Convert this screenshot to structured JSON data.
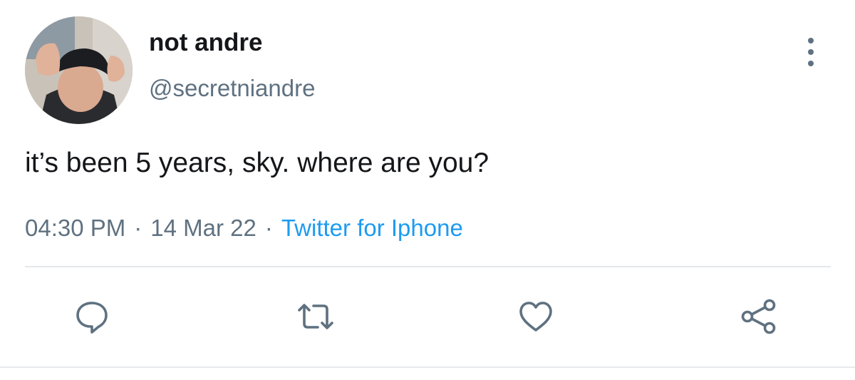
{
  "author": {
    "display_name": "not andre",
    "handle": "@secretniandre"
  },
  "tweet": {
    "text": "it’s been 5 years, sky. where are you?"
  },
  "meta": {
    "time": "04:30 PM",
    "separator": "·",
    "date": "14 Mar 22",
    "source": "Twitter for Iphone"
  },
  "icons": {
    "more": "more-vertical-icon",
    "reply": "reply-bubble-icon",
    "retweet": "retweet-icon",
    "like": "heart-icon",
    "share": "share-icon"
  },
  "colors": {
    "text_primary": "#141619",
    "text_secondary": "#5f7180",
    "link": "#1d9bf0",
    "divider": "#e6e9ec"
  }
}
